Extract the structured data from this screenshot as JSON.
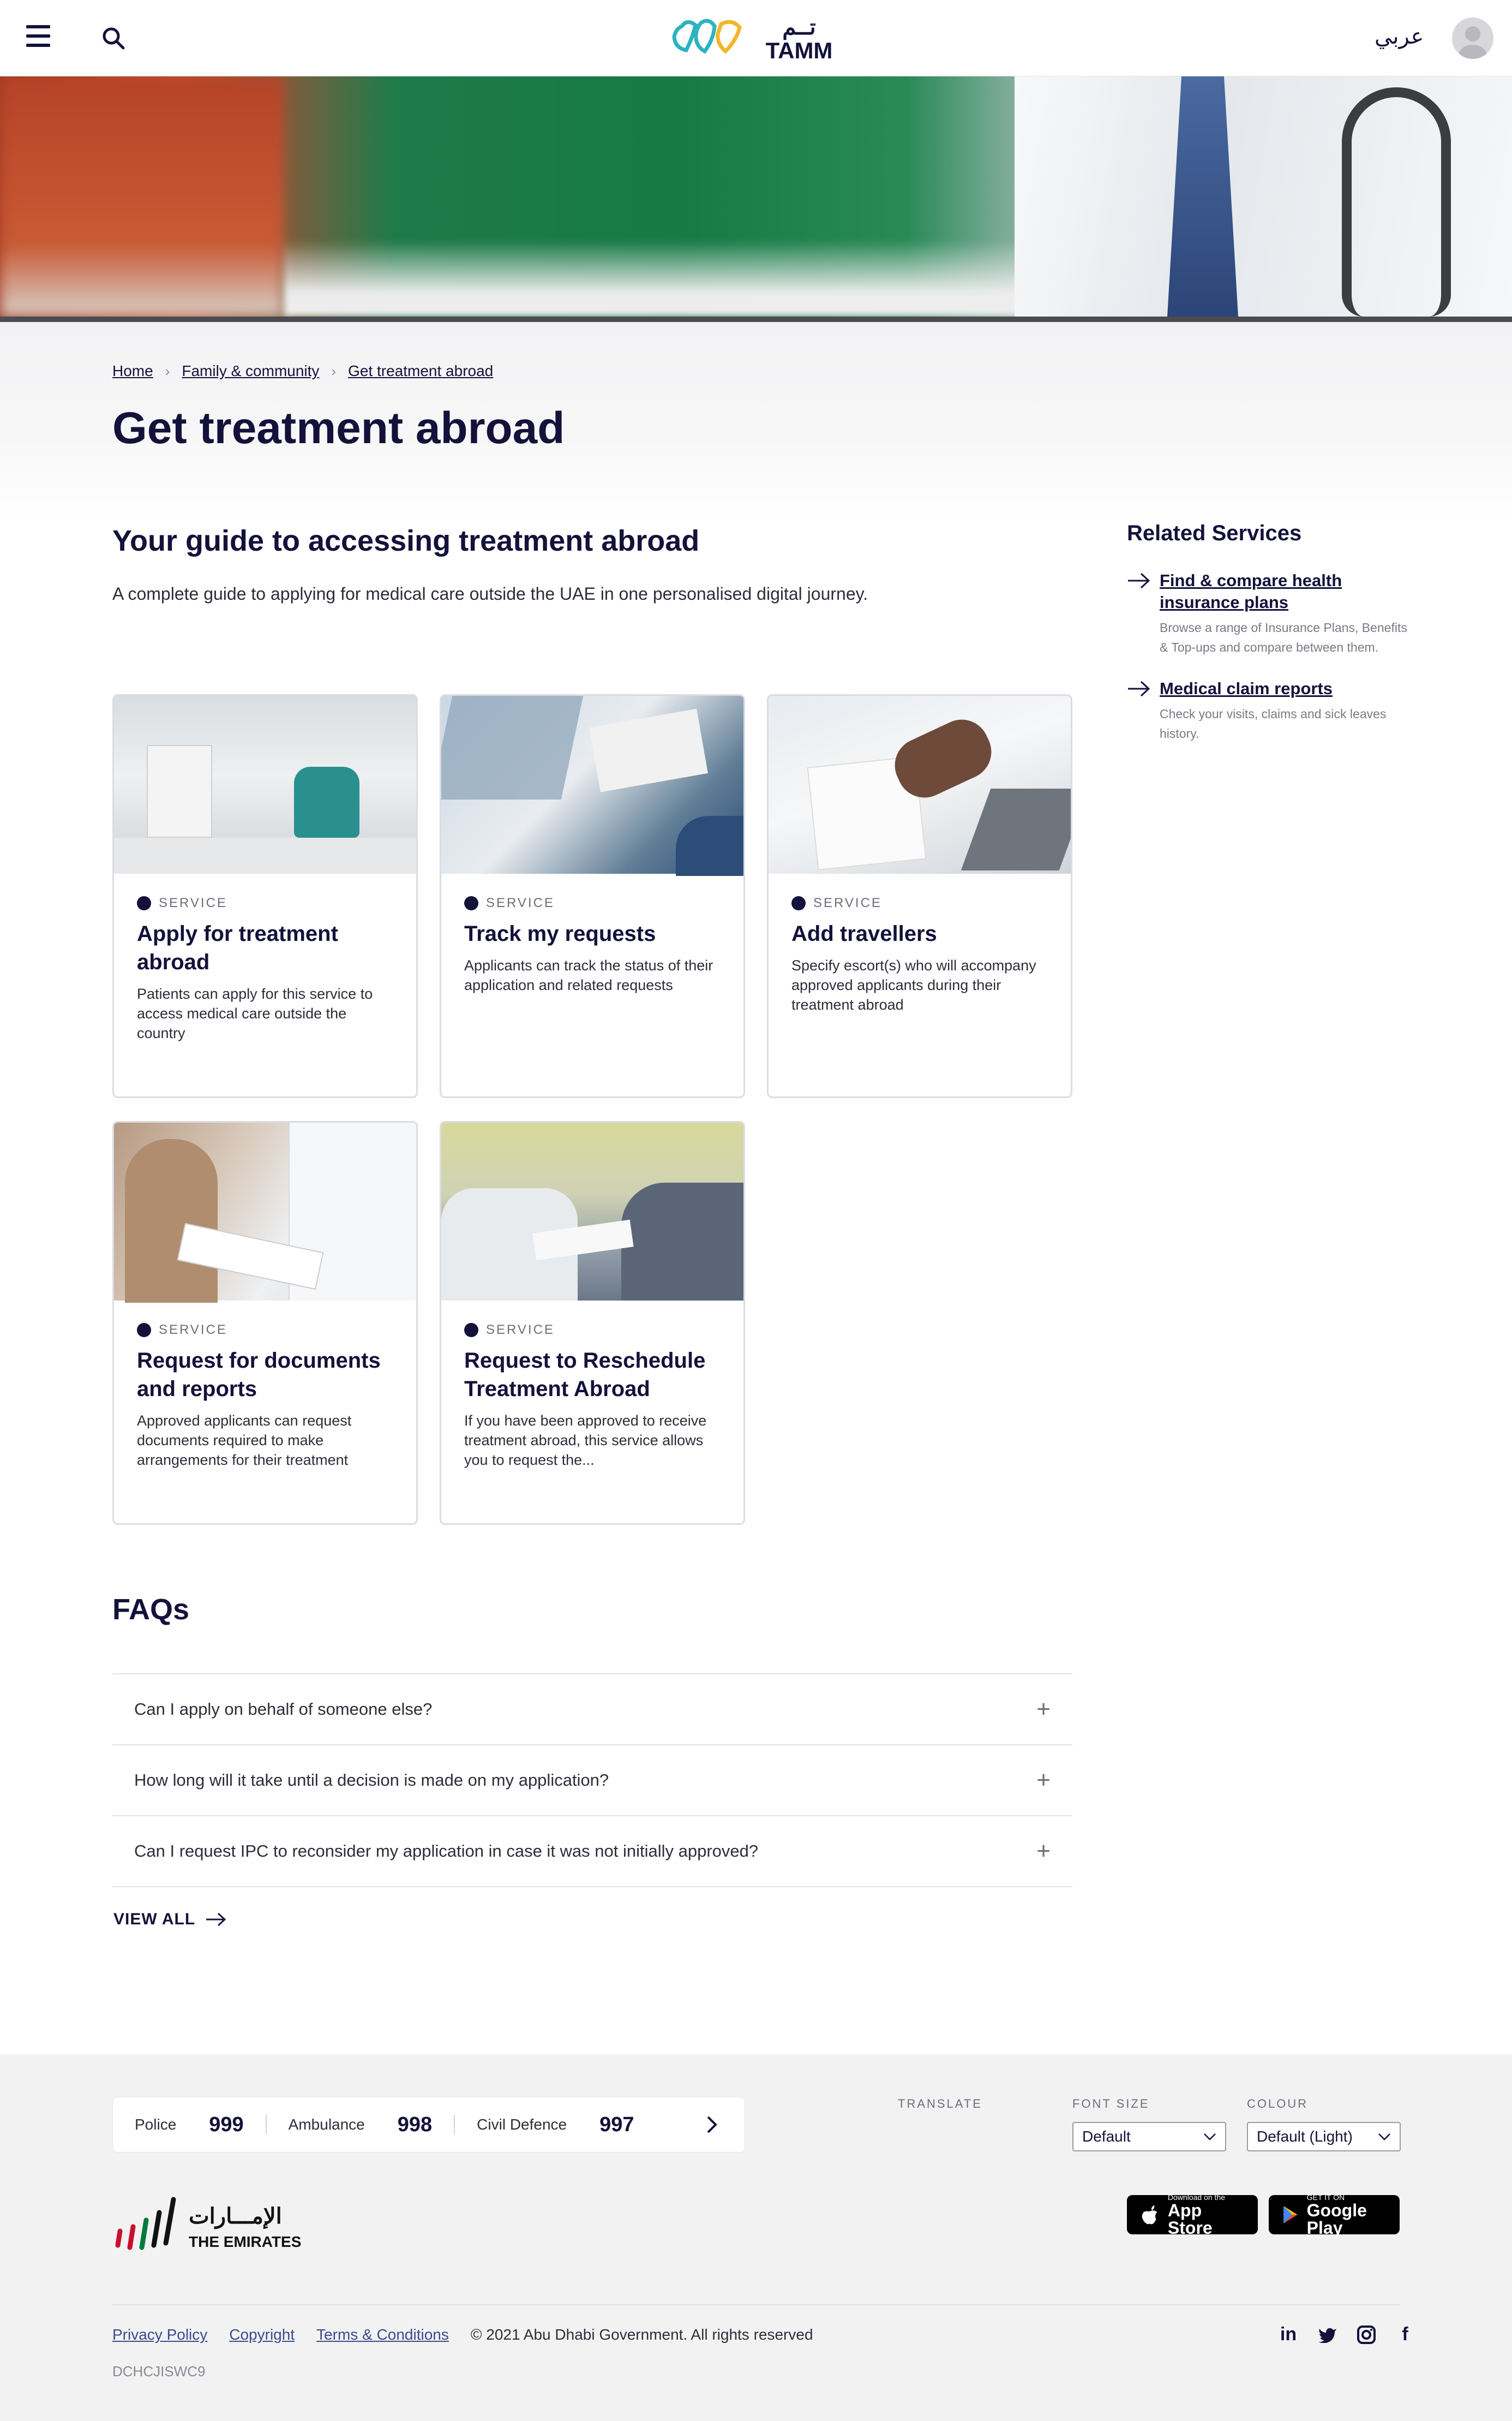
{
  "header": {
    "logo_latin": "TAMM",
    "logo_arabic": "تــم",
    "language_toggle": "عربي"
  },
  "breadcrumb": {
    "home": "Home",
    "family": "Family & community",
    "current": "Get treatment abroad"
  },
  "page": {
    "title": "Get treatment abroad",
    "guide_title": "Your guide to accessing treatment abroad",
    "guide_description": "A complete guide to applying for medical care outside the UAE in one personalised digital journey."
  },
  "related": {
    "heading": "Related Services",
    "items": [
      {
        "label": "Find & compare health insurance plans",
        "description": "Browse a range of Insurance Plans, Benefits & Top-ups and compare between them."
      },
      {
        "label": "Medical claim reports",
        "description": "Check your visits, claims and sick leaves history."
      }
    ]
  },
  "cards": [
    {
      "tag": "SERVICE",
      "title": "Apply for treatment abroad",
      "description": "Patients can apply for this service to access medical care outside the country"
    },
    {
      "tag": "SERVICE",
      "title": "Track my requests",
      "description": "Applicants can track the status of their application and related requests"
    },
    {
      "tag": "SERVICE",
      "title": "Add travellers",
      "description": "Specify escort(s) who will accompany approved applicants during their treatment abroad"
    },
    {
      "tag": "SERVICE",
      "title": "Request for documents and reports",
      "description": "Approved applicants can request documents required to make arrangements for their treatment"
    },
    {
      "tag": "SERVICE",
      "title": "Request to Reschedule Treatment Abroad",
      "description": "If you have been approved to receive treatment abroad, this service allows you to request the..."
    }
  ],
  "faq": {
    "title": "FAQs",
    "items": [
      "Can I apply on behalf of someone else?",
      "How long will it take until a decision is made on my application?",
      "Can I request IPC to reconsider my application in case it was not initially approved?"
    ],
    "view_all": "VIEW ALL"
  },
  "footer": {
    "emergency": [
      {
        "name": "Police",
        "number": "999"
      },
      {
        "name": "Ambulance",
        "number": "998"
      },
      {
        "name": "Civil Defence",
        "number": "997"
      }
    ],
    "translate_label": "TRANSLATE",
    "font_size_label": "FONT SIZE",
    "font_size_value": "Default",
    "colour_label": "COLOUR",
    "colour_value": "Default (Light)",
    "emirates_arabic": "الإمـــارات",
    "emirates_latin": "THE EMIRATES",
    "app_store_small": "Download on the",
    "app_store_big": "App Store",
    "google_play_small": "GET IT ON",
    "google_play_big": "Google Play",
    "links": [
      "Privacy Policy",
      "Copyright",
      "Terms & Conditions"
    ],
    "copyright": "© 2021 Abu Dhabi Government. All rights reserved",
    "code": "DCHCJISWC9",
    "social": [
      "in",
      "t",
      "ig",
      "f"
    ]
  },
  "colors": {
    "primary": "#14123a",
    "footer_bg": "#f2f2f3",
    "link": "#3b4a8a",
    "logo_teal": "#2bb3c0",
    "logo_yellow": "#f2b62c"
  }
}
